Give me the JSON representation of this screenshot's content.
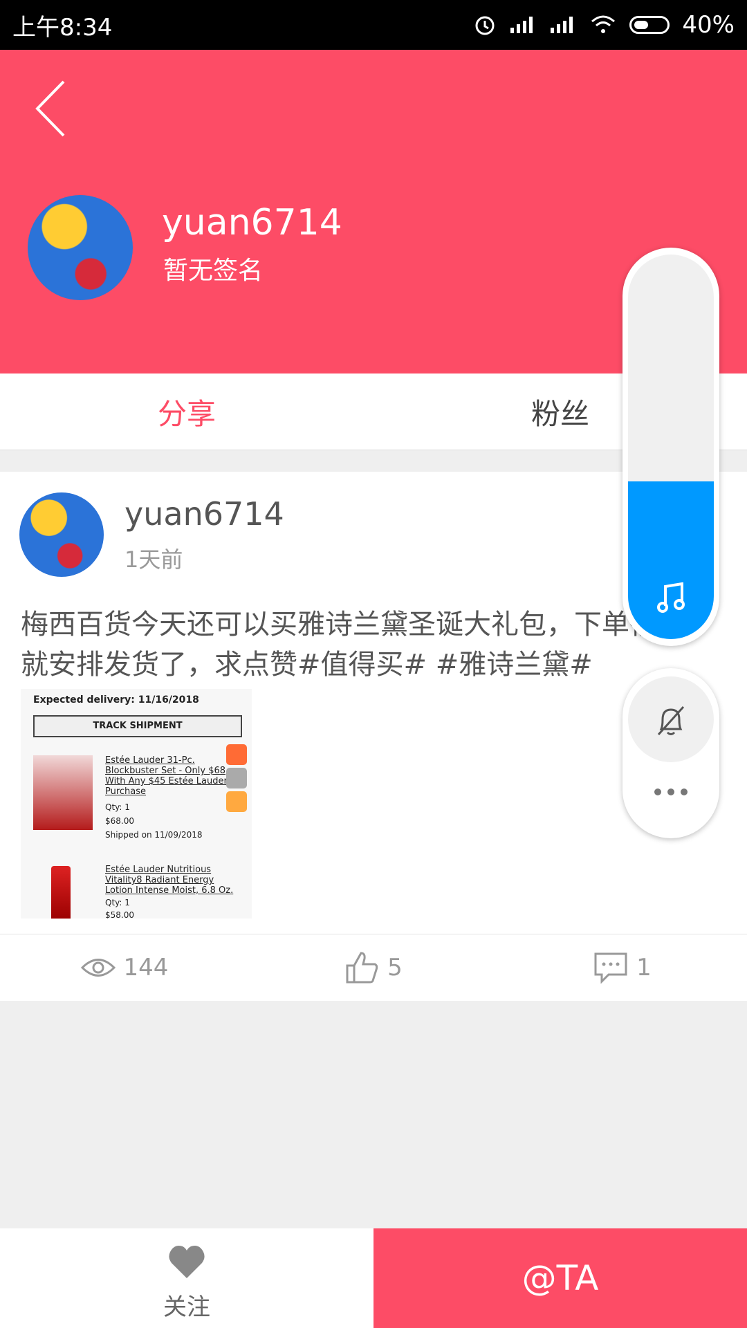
{
  "status_bar": {
    "time": "上午8:34",
    "battery": "40%"
  },
  "profile": {
    "username": "yuan6714",
    "signature": "暂无签名"
  },
  "tabs": [
    {
      "label": "分享",
      "active": true
    },
    {
      "label": "粉丝",
      "active": false
    }
  ],
  "post": {
    "username": "yuan6714",
    "time": "1天前",
    "text": "梅西百货今天还可以买雅诗兰黛圣诞大礼包，下单很快就安排发货了，求点赞#值得买# #雅诗兰黛#",
    "image": {
      "delivery": "Expected delivery: 11/16/2018",
      "track_button": "TRACK SHIPMENT",
      "item1_title": "Estée Lauder 31-Pc. Blockbuster Set - Only $68 With Any $45 Estée Lauder Purchase",
      "item1_qty": "Qty: 1",
      "item1_price": "$68.00",
      "item1_shipped": "Shipped on 11/09/2018",
      "item2_title": "Estée Lauder Nutritious Vitality8 Radiant Energy Lotion Intense Moist, 6.8 Oz.",
      "item2_qty": "Qty: 1",
      "item2_price": "$58.00"
    },
    "stats": {
      "views": "144",
      "likes": "5",
      "comments": "1"
    }
  },
  "overlay": {
    "volume_level": 0.41,
    "accent_color": "#0099ff"
  },
  "bottom": {
    "follow_label": "关注",
    "at_label": "@TA"
  },
  "colors": {
    "brand": "#fd4c66"
  }
}
